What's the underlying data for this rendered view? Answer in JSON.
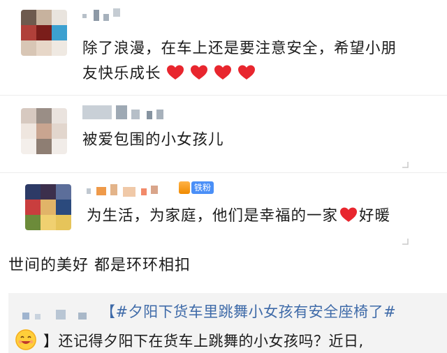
{
  "comments": [
    {
      "text_line1": "除了浪漫，在车上还是要注意安全，希望小朋",
      "text_line2": "友快乐成长",
      "hearts": 4
    },
    {
      "text_line1": "被爱包围的小女孩儿"
    },
    {
      "badge_label": "铁粉",
      "text_before_heart": "为生活，为家庭，他们是幸福的一家",
      "text_after_heart": "好暖"
    }
  ],
  "plain_comment": "世间的美好 都是环环相扣",
  "repost": {
    "topic": "【#夕阳下货车里跳舞小女孩有安全座椅了#",
    "body": "】还记得夕阳下在货车上跳舞的小女孩吗？近日,"
  },
  "colors": {
    "heart": "#e8262e",
    "topic_link": "#3e6aa8",
    "badge_blue": "#4a8ff7",
    "repost_bg": "#f3f3f3"
  },
  "icons": [
    "heart-icon",
    "reply-icon",
    "fan-badge-icon",
    "smile-emoji-icon"
  ]
}
